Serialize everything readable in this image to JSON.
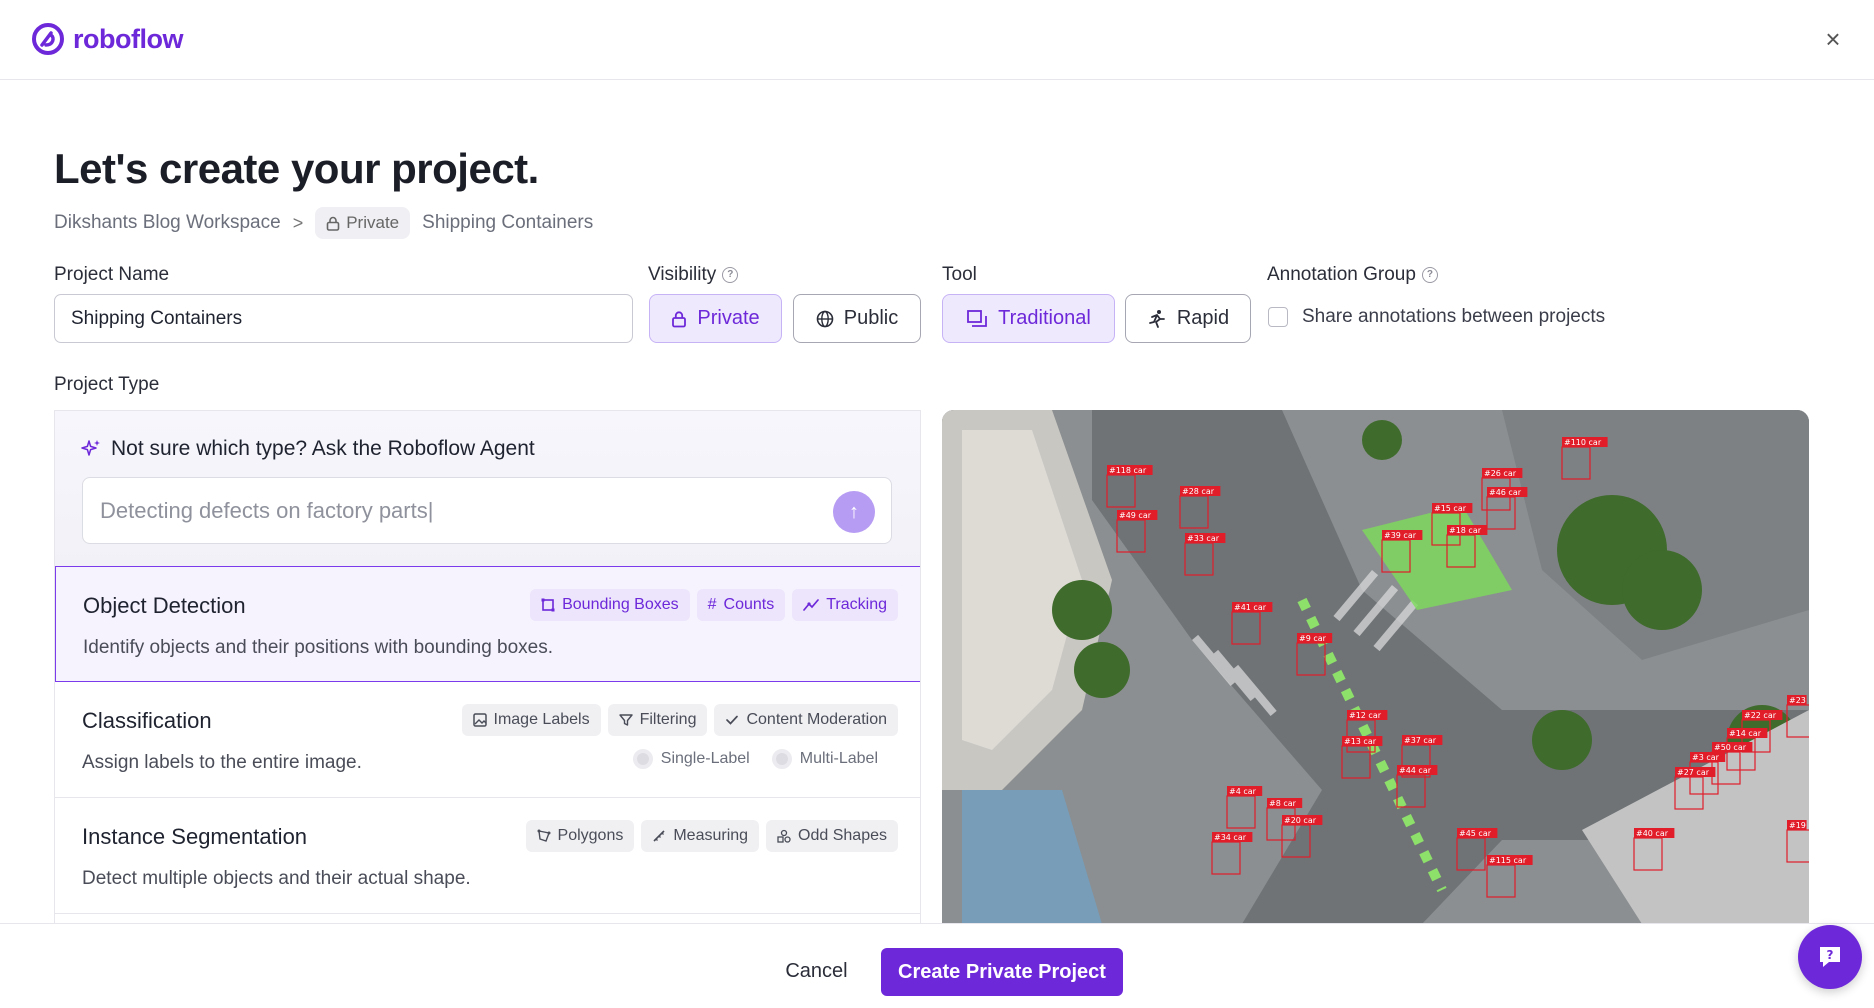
{
  "header": {
    "logo_text": "roboflow",
    "close_label": "×"
  },
  "page_title": "Let's create your project.",
  "breadcrumb": {
    "workspace": "Dikshants Blog Workspace",
    "separator": ">",
    "visibility_pill": "Private",
    "project": "Shipping Containers"
  },
  "form": {
    "project_name_label": "Project Name",
    "project_name_value": "Shipping Containers",
    "visibility_label": "Visibility",
    "visibility_options": [
      {
        "label": "Private",
        "selected": true
      },
      {
        "label": "Public",
        "selected": false
      }
    ],
    "tool_label": "Tool",
    "tool_options": [
      {
        "label": "Traditional",
        "selected": true
      },
      {
        "label": "Rapid",
        "selected": false
      }
    ],
    "annotation_group_label": "Annotation Group",
    "share_annotations_label": "Share annotations between projects",
    "share_annotations_checked": false,
    "project_type_label": "Project Type"
  },
  "agent": {
    "title": "Not sure which type? Ask the Roboflow Agent",
    "placeholder": "Detecting defects on factory parts|"
  },
  "project_types": [
    {
      "title": "Object Detection",
      "description": "Identify objects and their positions with bounding boxes.",
      "tags": [
        "Bounding Boxes",
        "Counts",
        "Tracking"
      ],
      "selected": true
    },
    {
      "title": "Classification",
      "description": "Assign labels to the entire image.",
      "tags": [
        "Image Labels",
        "Filtering",
        "Content Moderation"
      ],
      "options": [
        "Single-Label",
        "Multi-Label"
      ]
    },
    {
      "title": "Instance Segmentation",
      "description": "Detect multiple objects and their actual shape.",
      "tags": [
        "Polygons",
        "Measuring",
        "Odd Shapes"
      ]
    }
  ],
  "preview": {
    "labels": [
      "#118 car",
      "#28 car",
      "#49 car",
      "#33 car",
      "#26 car",
      "#46 car",
      "#15 car",
      "#110 car",
      "#39 car",
      "#18 car",
      "#41 car",
      "#9 car",
      "#12 car",
      "#13 car",
      "#37 car",
      "#44 car",
      "#4 car",
      "#8 car",
      "#20 car",
      "#34 car",
      "#45 car",
      "#115 car",
      "#22 car",
      "#14 car",
      "#50 car",
      "#3 car",
      "#27 car",
      "#40 car",
      "#19",
      "#23"
    ]
  },
  "footer": {
    "cancel_label": "Cancel",
    "create_label": "Create Private Project"
  },
  "colors": {
    "brand": "#6d28d9",
    "selected_bg": "#f6f2fe",
    "box_red": "#e11d2a",
    "bike_lane": "#7ddc5a"
  }
}
